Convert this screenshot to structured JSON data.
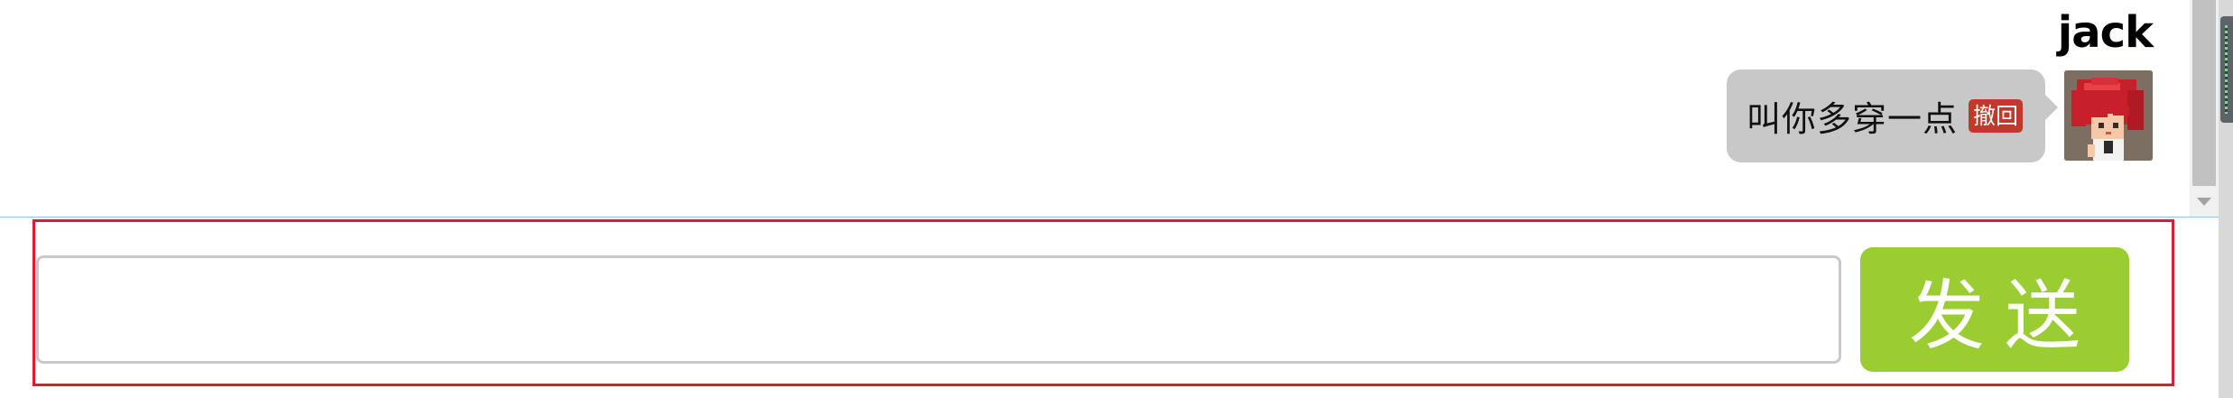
{
  "chat": {
    "messages": [
      {
        "sender": "jack",
        "text": "叫你多穿一点",
        "recall_label": "撤回",
        "avatar_icon": "red-haired-character-avatar"
      }
    ]
  },
  "composer": {
    "input_value": "",
    "input_placeholder": "",
    "send_label": "发送"
  },
  "colors": {
    "bubble": "#c8c8c8",
    "recall": "#c0392b",
    "send": "#9acd32",
    "frame": "#e01c2a"
  }
}
